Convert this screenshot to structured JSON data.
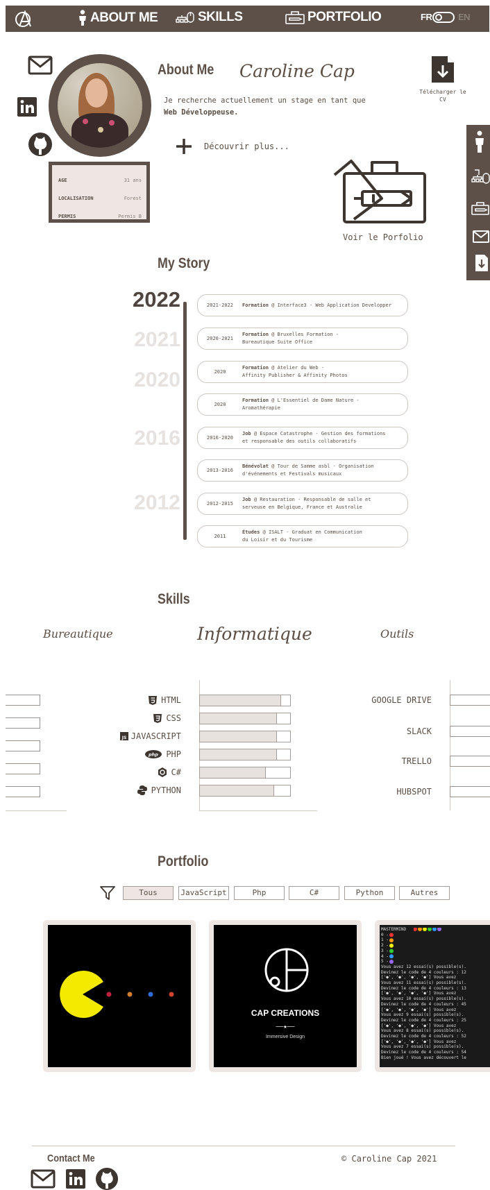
{
  "nav": {
    "logo": "CC",
    "about": "ABOUT ME",
    "skills": "SKILLS",
    "portfolio": "PORTFOLIO",
    "lang_fr": "FR",
    "lang_en": "EN"
  },
  "about": {
    "title": "About Me",
    "name": "Caroline Cap",
    "text1": "Je recherche actuellement un stage en tant que",
    "text2": "Web Développeuse.",
    "discover": "Découvrir plus...",
    "download": "Télécharger le CV",
    "portfolio_link": "Voir le Porfolio",
    "info": [
      {
        "k": "AGE",
        "v": "31 ans"
      },
      {
        "k": "LOCALISATION",
        "v": "Forest"
      },
      {
        "k": "PERMIS",
        "v": "Permis B"
      }
    ]
  },
  "story": {
    "title": "My Story",
    "years": [
      "2022",
      "2021",
      "2020",
      "2016",
      "2012"
    ],
    "cards": [
      {
        "y": "2021-2022",
        "b": "Formation",
        "t1": " @ Interface3 - Web Application Developper",
        "t2": ""
      },
      {
        "y": "2020-2021",
        "b": "Formation",
        "t1": " @ Bruxelles Formation -",
        "t2": "Bureautique Suite Office"
      },
      {
        "y": "2020",
        "b": "Formation",
        "t1": " @ Atelier du Web -",
        "t2": "Affinity Publisher & Affinity Photos"
      },
      {
        "y": "2020",
        "b": "Formation",
        "t1": " @ L'Essentiel de Dame Nature -",
        "t2": "Aromathérapie"
      },
      {
        "y": "2016-2020",
        "b": "Job",
        "t1": " @ Espace Catastrophe - Gestion des formations",
        "t2": "et responsable des outils collaboratifs"
      },
      {
        "y": "2013-2016",
        "b": "Bénévolat",
        "t1": " @ Tour de Samme asbl - Organisation",
        "t2": "d'événements et Festivals musicaux"
      },
      {
        "y": "2012-2015",
        "b": "Job",
        "t1": " @ Restauration - Responsable de salle et",
        "t2": "serveuse en Belgique, France et Australie"
      },
      {
        "y": "2011",
        "b": "Études",
        "t1": " @ ISALT - Graduat en Communication",
        "t2": "du Loisir et du Tourisme"
      }
    ]
  },
  "skills": {
    "title": "Skills",
    "tab_office": "Bureautique",
    "tab_it": "Informatique",
    "tab_tools": "Outils",
    "it": [
      {
        "name": "HTML",
        "icon": "html5-icon",
        "level": 0.9
      },
      {
        "name": "CSS",
        "icon": "css3-icon",
        "level": 0.85
      },
      {
        "name": "JAVASCRIPT",
        "icon": "js-icon",
        "level": 0.85
      },
      {
        "name": "PHP",
        "icon": "php-icon",
        "level": 0.85
      },
      {
        "name": "C#",
        "icon": "csharp-icon",
        "level": 0.73
      },
      {
        "name": "PYTHON",
        "icon": "python-icon",
        "level": 0.82
      }
    ],
    "tools": [
      "GOOGLE DRIVE",
      "SLACK",
      "TRELLO",
      "HUBSPOT"
    ]
  },
  "portfolio": {
    "title": "Portfolio",
    "filters": [
      "Tous",
      "JavaScript",
      "Php",
      "C#",
      "Python",
      "Autres"
    ],
    "cap_title": "CAP CREATIONS",
    "cap_sub": "Immersive Design",
    "mm": [
      "MASTERMIND",
      "0 -",
      "1 -",
      "2 -",
      "3 -",
      "4 -",
      "5 -",
      "Vous avez 12 essai(s) possible(s).",
      "Devinez le code de 4 couleurs : 12",
      "['●', '●', '●', '●'] Vous avez",
      "Vous avez 11 essai(s) possible(s).",
      "Devinez le code de 4 couleurs : 13",
      "['●', '●', '●', '●'] Vous avez",
      "Vous avez 10 essai(s) possible(s).",
      "Devinez le code de 4 couleurs : 45",
      "['●', '●', '●', '●'] Vous avez",
      "Vous avez 9 essai(s) possible(s).",
      "Devinez le code de 4 couleurs : 25",
      "['●', '●', '●', '●'] Vous avez",
      "Vous avez 8 essai(s) possible(s).",
      "Devinez le code de 4 couleurs : 52",
      "['●', '●', '●', '●'] Vous avez",
      "Vous avez 7 essai(s) possible(s).",
      "Devinez le code de 4 couleurs : 54",
      "Bien joué ! Vous avez découvert le"
    ]
  },
  "footer": {
    "contact": "Contact Me",
    "copyright": "Caroline Cap 2021",
    "copy_symbol": "©"
  },
  "colors": {
    "brand": "#5c5048",
    "light": "#ede6e2"
  }
}
